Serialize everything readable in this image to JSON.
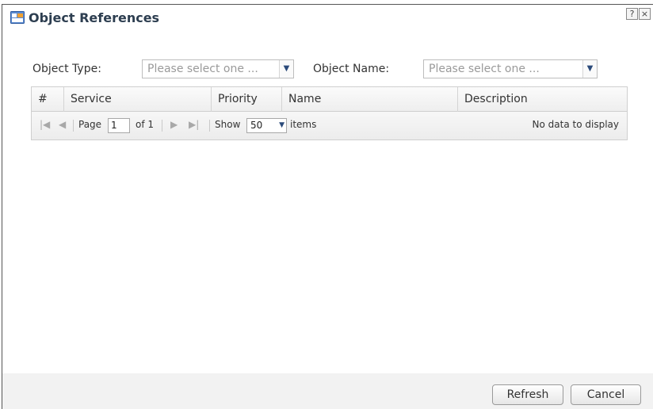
{
  "window": {
    "title": "Object References",
    "help_label": "?",
    "close_label": "×"
  },
  "filters": {
    "object_type_label": "Object Type:",
    "object_type_value": "Please select one ...",
    "object_name_label": "Object Name:",
    "object_name_value": "Please select one ..."
  },
  "table": {
    "columns": [
      "#",
      "Service",
      "Priority",
      "Name",
      "Description"
    ]
  },
  "pager": {
    "page_label": "Page",
    "page_value": "1",
    "of_label": "of 1",
    "show_label": "Show",
    "show_value": "50",
    "items_label": "items",
    "empty_text": "No data to display"
  },
  "buttons": {
    "refresh": "Refresh",
    "cancel": "Cancel"
  }
}
